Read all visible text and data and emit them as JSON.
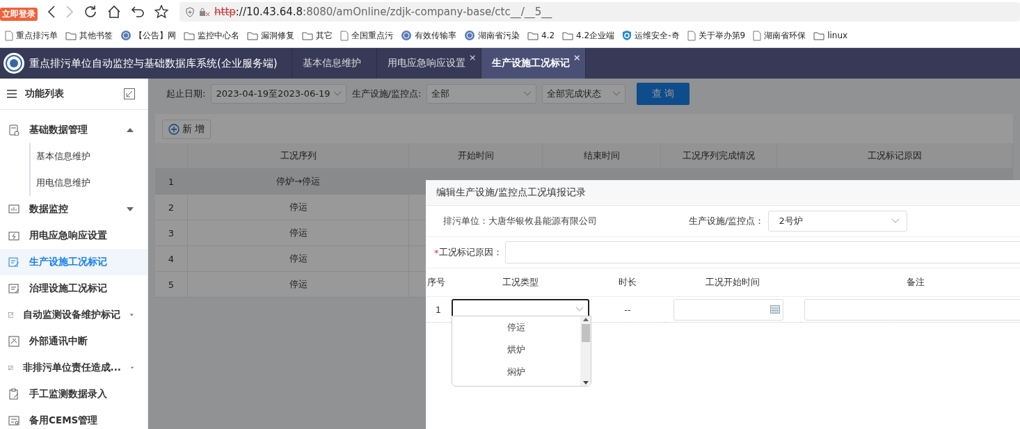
{
  "browser": {
    "login_badge": "立即登录",
    "url": {
      "scheme": "http",
      "host": "://10.43.64.8",
      "path": ":8080/amOnline/zdjk-company-base/ctc__/__5__"
    },
    "bookmarks": [
      {
        "label": "重点排污单",
        "kind": "page"
      },
      {
        "label": "其他书签",
        "kind": "folder"
      },
      {
        "label": "【公告】网",
        "kind": "site"
      },
      {
        "label": "监控中心名",
        "kind": "folder"
      },
      {
        "label": "漏洞修复",
        "kind": "folder"
      },
      {
        "label": "其它",
        "kind": "folder"
      },
      {
        "label": "全国重点污",
        "kind": "page"
      },
      {
        "label": "有效传输率",
        "kind": "site"
      },
      {
        "label": "湖南省污染",
        "kind": "site"
      },
      {
        "label": "4.2",
        "kind": "folder"
      },
      {
        "label": "4.2企业端",
        "kind": "folder"
      },
      {
        "label": "运维安全-奇",
        "kind": "shield"
      },
      {
        "label": "关于举办第9",
        "kind": "page"
      },
      {
        "label": "湖南省环保",
        "kind": "page"
      },
      {
        "label": "linux",
        "kind": "folder"
      }
    ]
  },
  "app": {
    "title": "重点排污单位自动监控与基础数据库系统(企业服务端)",
    "tabs": [
      {
        "label": "基本信息维护",
        "selected": false
      },
      {
        "label": "用电应急响应设置",
        "selected": false,
        "close": "×"
      },
      {
        "label": "生产设施工况标记",
        "selected": true,
        "close": "×"
      }
    ]
  },
  "sidebar": {
    "title": "功能列表",
    "items": [
      {
        "label": "基础数据管理",
        "kind": "group",
        "selected": false,
        "expanded": true,
        "children": [
          {
            "label": "基本信息维护",
            "selected": false
          },
          {
            "label": "用电信息维护",
            "selected": false
          }
        ]
      },
      {
        "label": "数据监控",
        "kind": "group",
        "selected": false,
        "expanded": false
      },
      {
        "label": "用电应急响应设置",
        "kind": "link",
        "selected": false
      },
      {
        "label": "生产设施工况标记",
        "kind": "link",
        "selected": true
      },
      {
        "label": "治理设施工况标记",
        "kind": "link",
        "selected": false
      },
      {
        "label": "自动监测设备维护标记",
        "kind": "group",
        "selected": false,
        "expanded": false
      },
      {
        "label": "外部通讯中断",
        "kind": "link",
        "selected": false
      },
      {
        "label": "非排污单位责任造成...",
        "kind": "group",
        "selected": false,
        "expanded": false
      },
      {
        "label": "手工监测数据录入",
        "kind": "link",
        "selected": false
      },
      {
        "label": "备用CEMS管理",
        "kind": "link",
        "selected": false
      }
    ]
  },
  "filters": {
    "date_label": "起止日期:",
    "date_value": "2023-04-19至2023-06-19",
    "facility_label": "生产设施/监控点:",
    "facility_value": "全部",
    "status_value": "全部完成状态",
    "query_button": "查 询"
  },
  "add_button": "新 增",
  "table": {
    "columns": [
      "工况序列",
      "开始时间",
      "结束时间",
      "工况序列完成情况",
      "工况标记原因"
    ],
    "rows": [
      {
        "index": "1",
        "sequence": "停炉→停运",
        "selected": true
      },
      {
        "index": "2",
        "sequence": "停运",
        "selected": false
      },
      {
        "index": "3",
        "sequence": "停运",
        "selected": false
      },
      {
        "index": "4",
        "sequence": "停运",
        "selected": false
      },
      {
        "index": "5",
        "sequence": "停运",
        "selected": false
      }
    ]
  },
  "modal": {
    "title": "编辑生产设施/监控点工况填报记录",
    "unit_text": "排污单位：大唐华银攸县能源有限公司",
    "facility_label": "生产设施/监控点：",
    "facility_value": "2号炉",
    "reason_label": "工况标记原因：",
    "required_mark": "*",
    "columns": [
      "序号",
      "工况类型",
      "时长",
      "工况开始时间",
      "备注"
    ],
    "rows": [
      {
        "index": "1",
        "duration": "--"
      }
    ],
    "dropdown": {
      "options": [
        "停运",
        "烘炉",
        "焖炉"
      ]
    }
  }
}
